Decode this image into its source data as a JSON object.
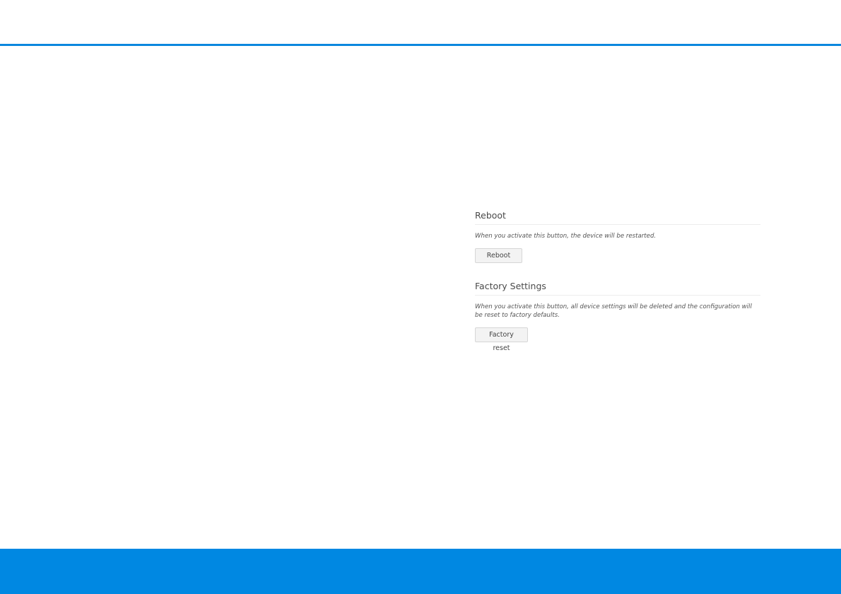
{
  "reboot": {
    "title": "Reboot",
    "description": "When you activate this button, the device will be restarted.",
    "button_label": "Reboot"
  },
  "factory": {
    "title": "Factory Settings",
    "description": "When you activate this button, all device settings will be deleted and the configuration will be reset to factory defaults.",
    "button_label": "Factory reset"
  },
  "colors": {
    "accent": "#0088e2"
  }
}
